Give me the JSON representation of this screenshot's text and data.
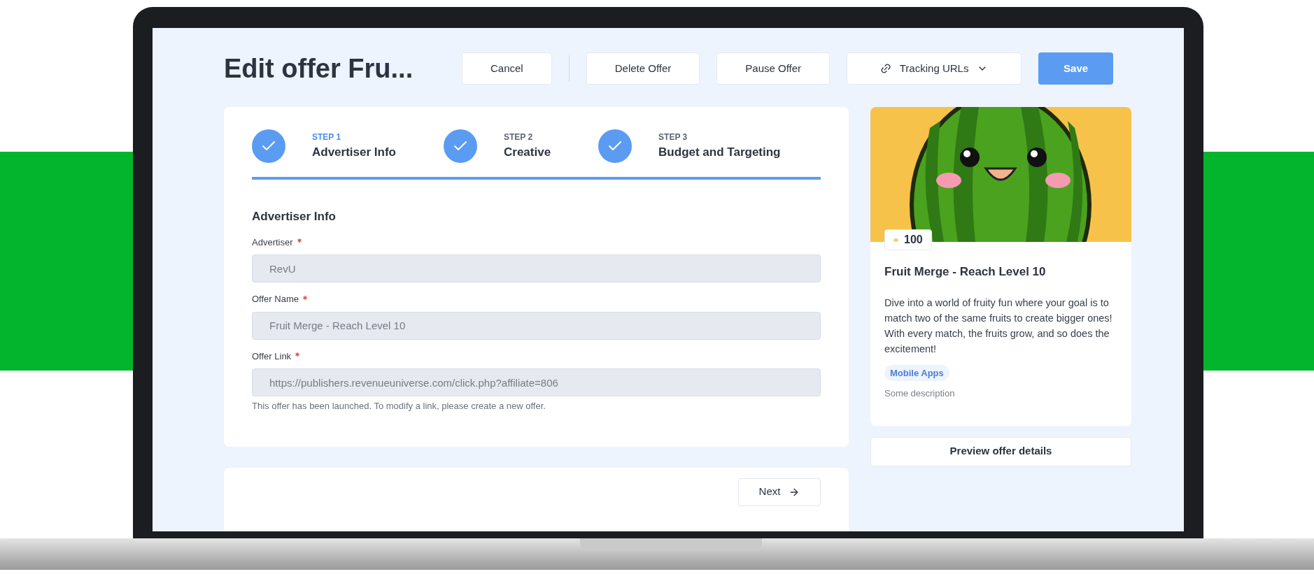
{
  "header": {
    "title": "Edit offer Fru...",
    "buttons": [
      {
        "label": "Cancel",
        "kind": "plain"
      },
      {
        "label": "Delete Offer",
        "kind": "plain"
      },
      {
        "label": "Pause Offer",
        "kind": "plain"
      },
      {
        "label": "Tracking URLs",
        "kind": "dropdown"
      },
      {
        "label": "Save",
        "kind": "primary"
      }
    ]
  },
  "steps": [
    {
      "step": "STEP 1",
      "label": "Advertiser Info",
      "selected": true,
      "completed": true
    },
    {
      "step": "STEP 2",
      "label": "Creative",
      "selected": false,
      "completed": true
    },
    {
      "step": "STEP 3",
      "label": "Budget and Targeting",
      "selected": false,
      "completed": true
    }
  ],
  "form": {
    "heading": "Advertiser Info",
    "fields": [
      {
        "label": "Advertiser",
        "required": true,
        "value": "RevU",
        "disabled": true
      },
      {
        "label": "Offer Name",
        "required": true,
        "value": "Fruit Merge - Reach Level 10",
        "disabled": true
      },
      {
        "label": "Offer Link",
        "required": true,
        "value": "https://publishers.revenueuniverse.com/click.php?affiliate=806",
        "disabled": true
      }
    ],
    "note": "This offer has been launched. To modify a link, please create a new offer."
  },
  "footer": {
    "next": "Next"
  },
  "preview": {
    "points": "100",
    "title": "Fruit Merge - Reach Level 10",
    "description": "Dive into a world of fruity fun where your goal is to match two of the same fruits to create bigger ones! With every match, the fruits grow, and so does the excitement!",
    "tag": "Mobile Apps",
    "subtext": "Some description",
    "button": "Preview offer details"
  }
}
